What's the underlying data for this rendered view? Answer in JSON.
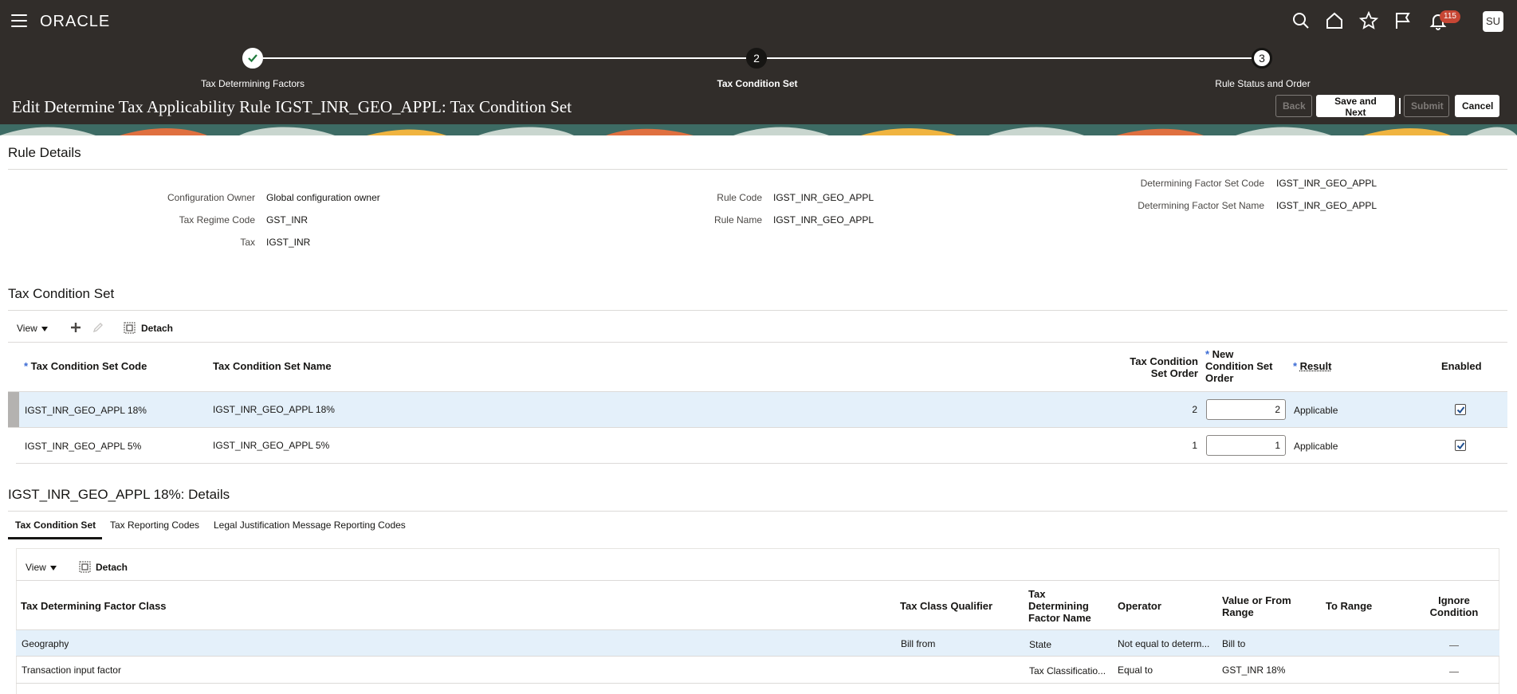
{
  "app": {
    "logo": "ORACLE",
    "notifications_count": "115",
    "avatar_initials": "SU"
  },
  "train": {
    "steps": [
      {
        "label": "Tax Determining Factors",
        "state": "done",
        "number": ""
      },
      {
        "label": "Tax Condition Set",
        "state": "current",
        "number": "2"
      },
      {
        "label": "Rule Status and Order",
        "state": "next",
        "number": "3"
      }
    ]
  },
  "page": {
    "title": "Edit Determine Tax Applicability Rule IGST_INR_GEO_APPL: Tax Condition Set",
    "buttons": {
      "back": "Back",
      "save_next": "Save and Next",
      "submit": "Submit",
      "cancel": "Cancel"
    }
  },
  "rule_details": {
    "title": "Rule Details",
    "config_owner_label": "Configuration Owner",
    "config_owner_value": "Global configuration owner",
    "regime_label": "Tax Regime Code",
    "regime_value": "GST_INR",
    "tax_label": "Tax",
    "tax_value": "IGST_INR",
    "rule_code_label": "Rule Code",
    "rule_code_value": "IGST_INR_GEO_APPL",
    "rule_name_label": "Rule Name",
    "rule_name_value": "IGST_INR_GEO_APPL",
    "dfs_code_label": "Determining Factor Set Code",
    "dfs_code_value": "IGST_INR_GEO_APPL",
    "dfs_name_label": "Determining Factor Set Name",
    "dfs_name_value": "IGST_INR_GEO_APPL"
  },
  "condition_set": {
    "title": "Tax Condition Set",
    "toolbar": {
      "view": "View",
      "detach": "Detach"
    },
    "columns": {
      "code": "Tax Condition Set Code",
      "name": "Tax Condition Set Name",
      "order_1": "Tax Condition",
      "order_2": "Set Order",
      "new_order_1": "New",
      "new_order_2": "Condition Set",
      "new_order_3": "Order",
      "result": "Result",
      "enabled": "Enabled"
    },
    "rows": [
      {
        "code": "IGST_INR_GEO_APPL 18%",
        "name": "IGST_INR_GEO_APPL 18%",
        "order": "2",
        "new_order": "2",
        "result": "Applicable",
        "enabled": true
      },
      {
        "code": "IGST_INR_GEO_APPL 5%",
        "name": "IGST_INR_GEO_APPL 5%",
        "order": "1",
        "new_order": "1",
        "result": "Applicable",
        "enabled": true
      }
    ]
  },
  "details": {
    "title": "IGST_INR_GEO_APPL 18%: Details",
    "tabs": [
      "Tax Condition Set",
      "Tax Reporting Codes",
      "Legal Justification Message Reporting Codes"
    ],
    "toolbar": {
      "view": "View",
      "detach": "Detach"
    },
    "columns": {
      "factor_class": "Tax Determining Factor Class",
      "qualifier": "Tax Class Qualifier",
      "factor_name_1": "Tax",
      "factor_name_2": "Determining",
      "factor_name_3": "Factor Name",
      "operator": "Operator",
      "value_from_1": "Value or From",
      "value_from_2": "Range",
      "to_range": "To Range",
      "ignore_1": "Ignore",
      "ignore_2": "Condition"
    },
    "rows": [
      {
        "factor_class": "Geography",
        "qualifier": "Bill from",
        "factor_name": "State",
        "operator": "Not equal to determ...",
        "value_from": "Bill to",
        "to_range": ""
      },
      {
        "factor_class": "Transaction input factor",
        "qualifier": "",
        "factor_name": "Tax Classificatio...",
        "operator": "Equal to",
        "value_from": "GST_INR 18%",
        "to_range": ""
      }
    ]
  },
  "colors": {
    "header_bg": "#312d2a",
    "selected_row": "#e4f0fa",
    "required_star": "#3a6ad4"
  }
}
